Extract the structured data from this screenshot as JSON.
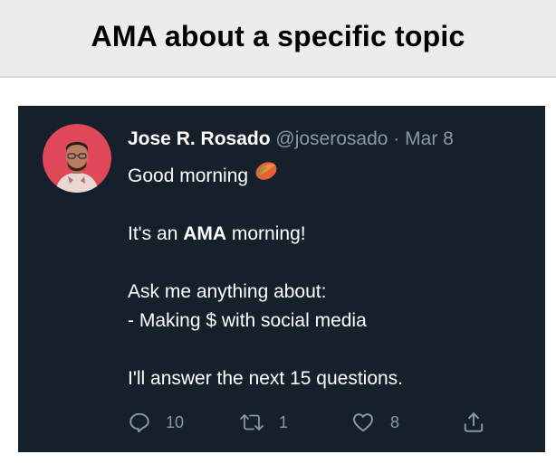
{
  "banner": {
    "title": "AMA about a specific topic"
  },
  "tweet": {
    "author_name": "Jose R. Rosado",
    "handle": "@joserosado",
    "separator": "·",
    "date": "Mar 8",
    "greeting": "Good morning",
    "greeting_emoji": "mango-emoji",
    "line2_pre": "It's an ",
    "line2_bold": "AMA",
    "line2_post": " morning!",
    "line3": "Ask me anything about:",
    "line4": "- Making $ with social media",
    "line5": "I'll answer the next 15 questions.",
    "actions": {
      "reply_count": "10",
      "retweet_count": "1",
      "like_count": "8"
    }
  },
  "colors": {
    "banner_bg": "#ececec",
    "tweet_bg": "#15202b",
    "text": "#ffffff",
    "muted": "#8899a6",
    "avatar_bg": "#e0485a"
  },
  "icons": [
    "reply-icon",
    "retweet-icon",
    "like-icon",
    "share-icon",
    "mango-emoji",
    "avatar"
  ]
}
